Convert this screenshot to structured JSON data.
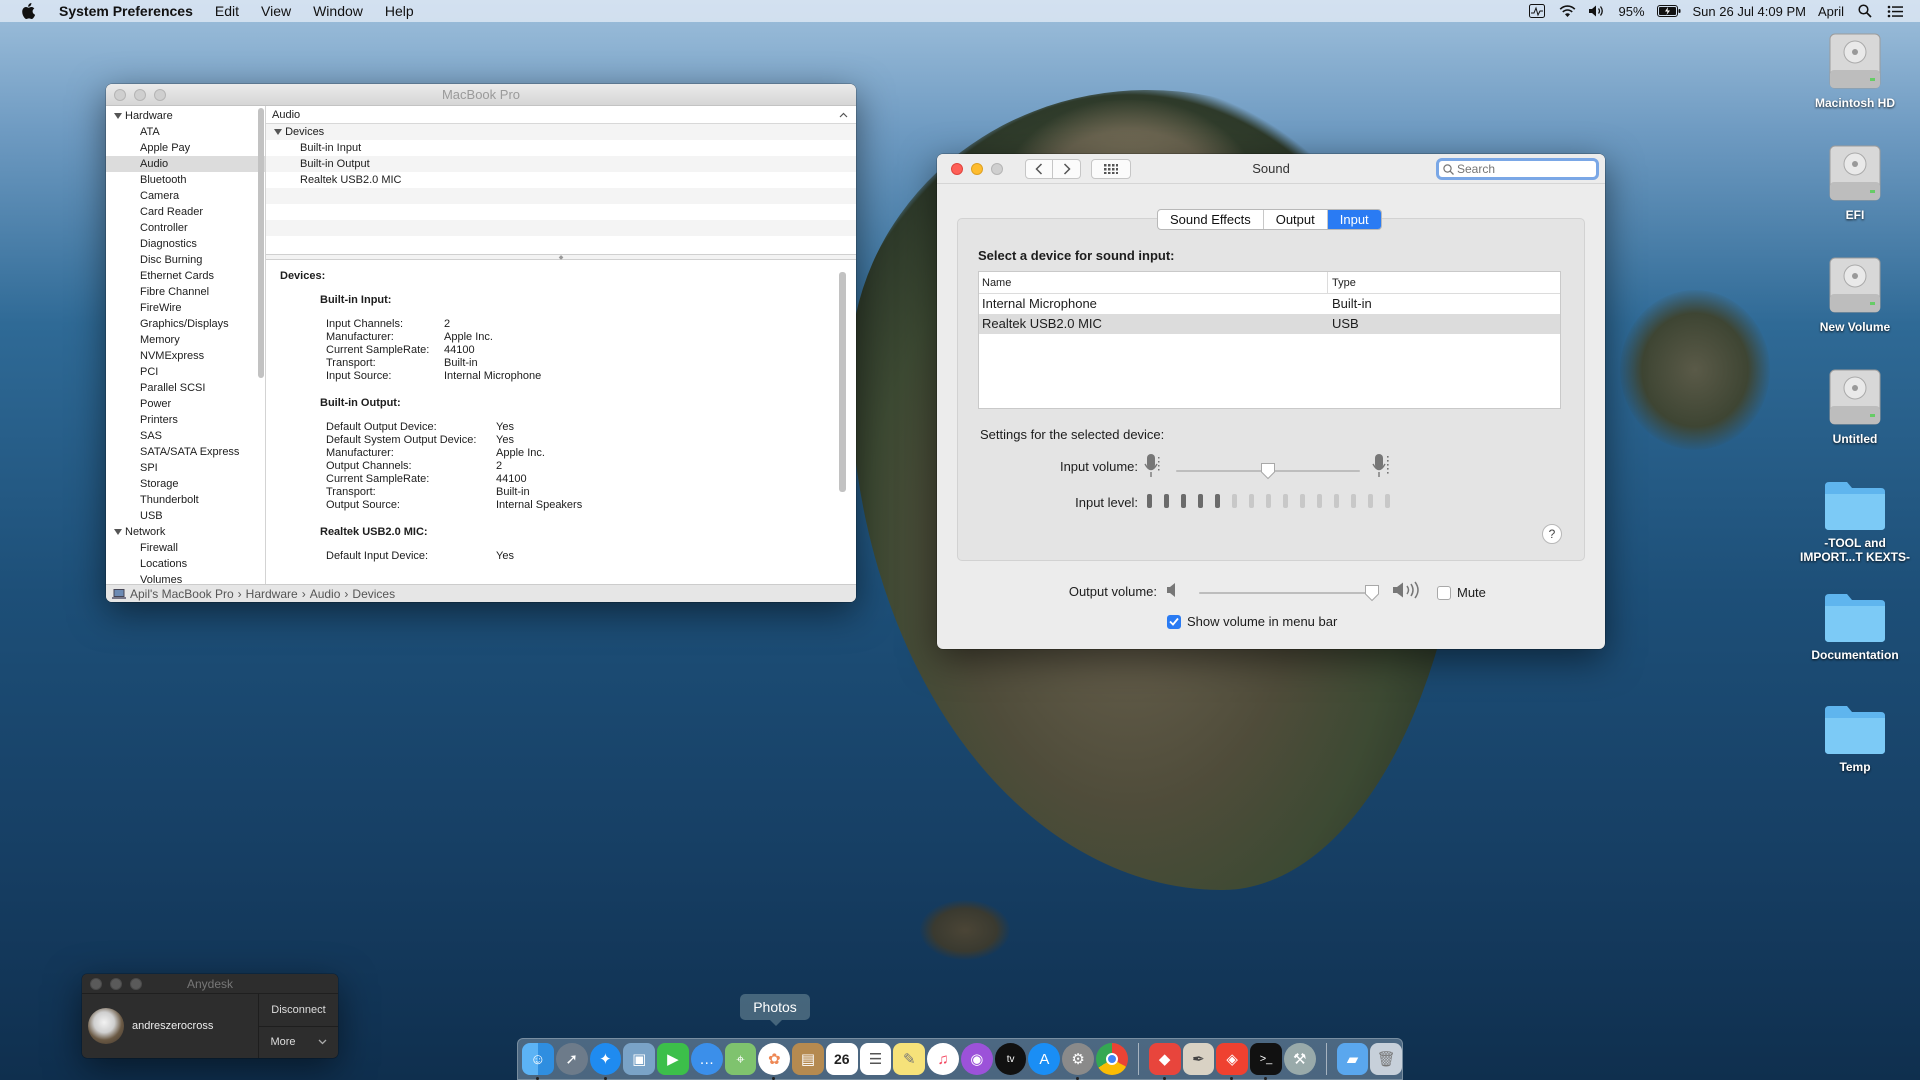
{
  "menubar": {
    "app_name": "System Preferences",
    "menus": [
      "Edit",
      "View",
      "Window",
      "Help"
    ],
    "battery": "95%",
    "datetime": "Sun 26 Jul  4:09 PM",
    "user": "April"
  },
  "sysinfo": {
    "title": "MacBook Pro",
    "sidebar": {
      "group_hardware": "Hardware",
      "hardware_items": [
        "ATA",
        "Apple Pay",
        "Audio",
        "Bluetooth",
        "Camera",
        "Card Reader",
        "Controller",
        "Diagnostics",
        "Disc Burning",
        "Ethernet Cards",
        "Fibre Channel",
        "FireWire",
        "Graphics/Displays",
        "Memory",
        "NVMExpress",
        "PCI",
        "Parallel SCSI",
        "Power",
        "Printers",
        "SAS",
        "SATA/SATA Express",
        "SPI",
        "Storage",
        "Thunderbolt",
        "USB"
      ],
      "selected": "Audio",
      "group_network": "Network",
      "network_items": [
        "Firewall",
        "Locations",
        "Volumes"
      ]
    },
    "header": "Audio",
    "table": {
      "group": "Devices",
      "items": [
        "Built-in Input",
        "Built-in Output",
        "Realtek USB2.0 MIC"
      ]
    },
    "detail": {
      "heading": "Devices:",
      "s1_title": "Built-in Input:",
      "s1": [
        {
          "k": "Input Channels:",
          "v": "2"
        },
        {
          "k": "Manufacturer:",
          "v": "Apple Inc."
        },
        {
          "k": "Current SampleRate:",
          "v": "44100"
        },
        {
          "k": "Transport:",
          "v": "Built-in"
        },
        {
          "k": "Input Source:",
          "v": "Internal Microphone"
        }
      ],
      "s2_title": "Built-in Output:",
      "s2": [
        {
          "k": "Default Output Device:",
          "v": "Yes"
        },
        {
          "k": "Default System Output Device:",
          "v": "Yes"
        },
        {
          "k": "Manufacturer:",
          "v": "Apple Inc."
        },
        {
          "k": "Output Channels:",
          "v": "2"
        },
        {
          "k": "Current SampleRate:",
          "v": "44100"
        },
        {
          "k": "Transport:",
          "v": "Built-in"
        },
        {
          "k": "Output Source:",
          "v": "Internal Speakers"
        }
      ],
      "s3_title": "Realtek USB2.0 MIC:",
      "s3": [
        {
          "k": "Default Input Device:",
          "v": "Yes"
        }
      ]
    },
    "path": [
      "Apil's MacBook Pro",
      "Hardware",
      "Audio",
      "Devices"
    ]
  },
  "sound": {
    "title": "Sound",
    "search_placeholder": "Search",
    "tabs": [
      "Sound Effects",
      "Output",
      "Input"
    ],
    "active_tab": "Input",
    "heading": "Select a device for sound input:",
    "col_name": "Name",
    "col_type": "Type",
    "devices": [
      {
        "name": "Internal Microphone",
        "type": "Built-in"
      },
      {
        "name": "Realtek USB2.0 MIC",
        "type": "USB"
      }
    ],
    "selected_device": "Realtek USB2.0 MIC",
    "settings_label": "Settings for the selected device:",
    "input_volume_label": "Input volume:",
    "input_volume": 0.5,
    "input_level_label": "Input level:",
    "input_level_segments_total": 15,
    "input_level_segments_on": 5,
    "help": "?",
    "output_volume_label": "Output volume:",
    "output_volume": 0.97,
    "mute_label": "Mute",
    "mute_checked": false,
    "show_volume_label": "Show volume in menu bar",
    "show_volume_checked": true,
    "accent": "#2a7bf3"
  },
  "desktop_icons": [
    {
      "label": "Macintosh HD",
      "kind": "drive"
    },
    {
      "label": "EFI",
      "kind": "drive"
    },
    {
      "label": "New Volume",
      "kind": "drive"
    },
    {
      "label": "Untitled",
      "kind": "drive"
    },
    {
      "label": "-TOOL and IMPORT...T KEXTS-",
      "kind": "folder"
    },
    {
      "label": "Documentation",
      "kind": "folder"
    },
    {
      "label": "Temp",
      "kind": "folder"
    }
  ],
  "anydesk": {
    "title": "Anydesk",
    "user": "andreszerocross",
    "disconnect": "Disconnect",
    "more": "More"
  },
  "dock": {
    "tooltip": "Photos",
    "calendar_day": "26",
    "apps": [
      "finder",
      "launchpad",
      "safari",
      "preview",
      "facetime",
      "messages",
      "maps",
      "photos",
      "notes-book",
      "calendar",
      "reminders",
      "notes",
      "music",
      "podcasts",
      "tv",
      "app-store",
      "system-preferences",
      "chrome",
      "git-app",
      "preview-2",
      "anydesk",
      "terminal",
      "xcode-tool",
      "downloads",
      "trash"
    ]
  }
}
